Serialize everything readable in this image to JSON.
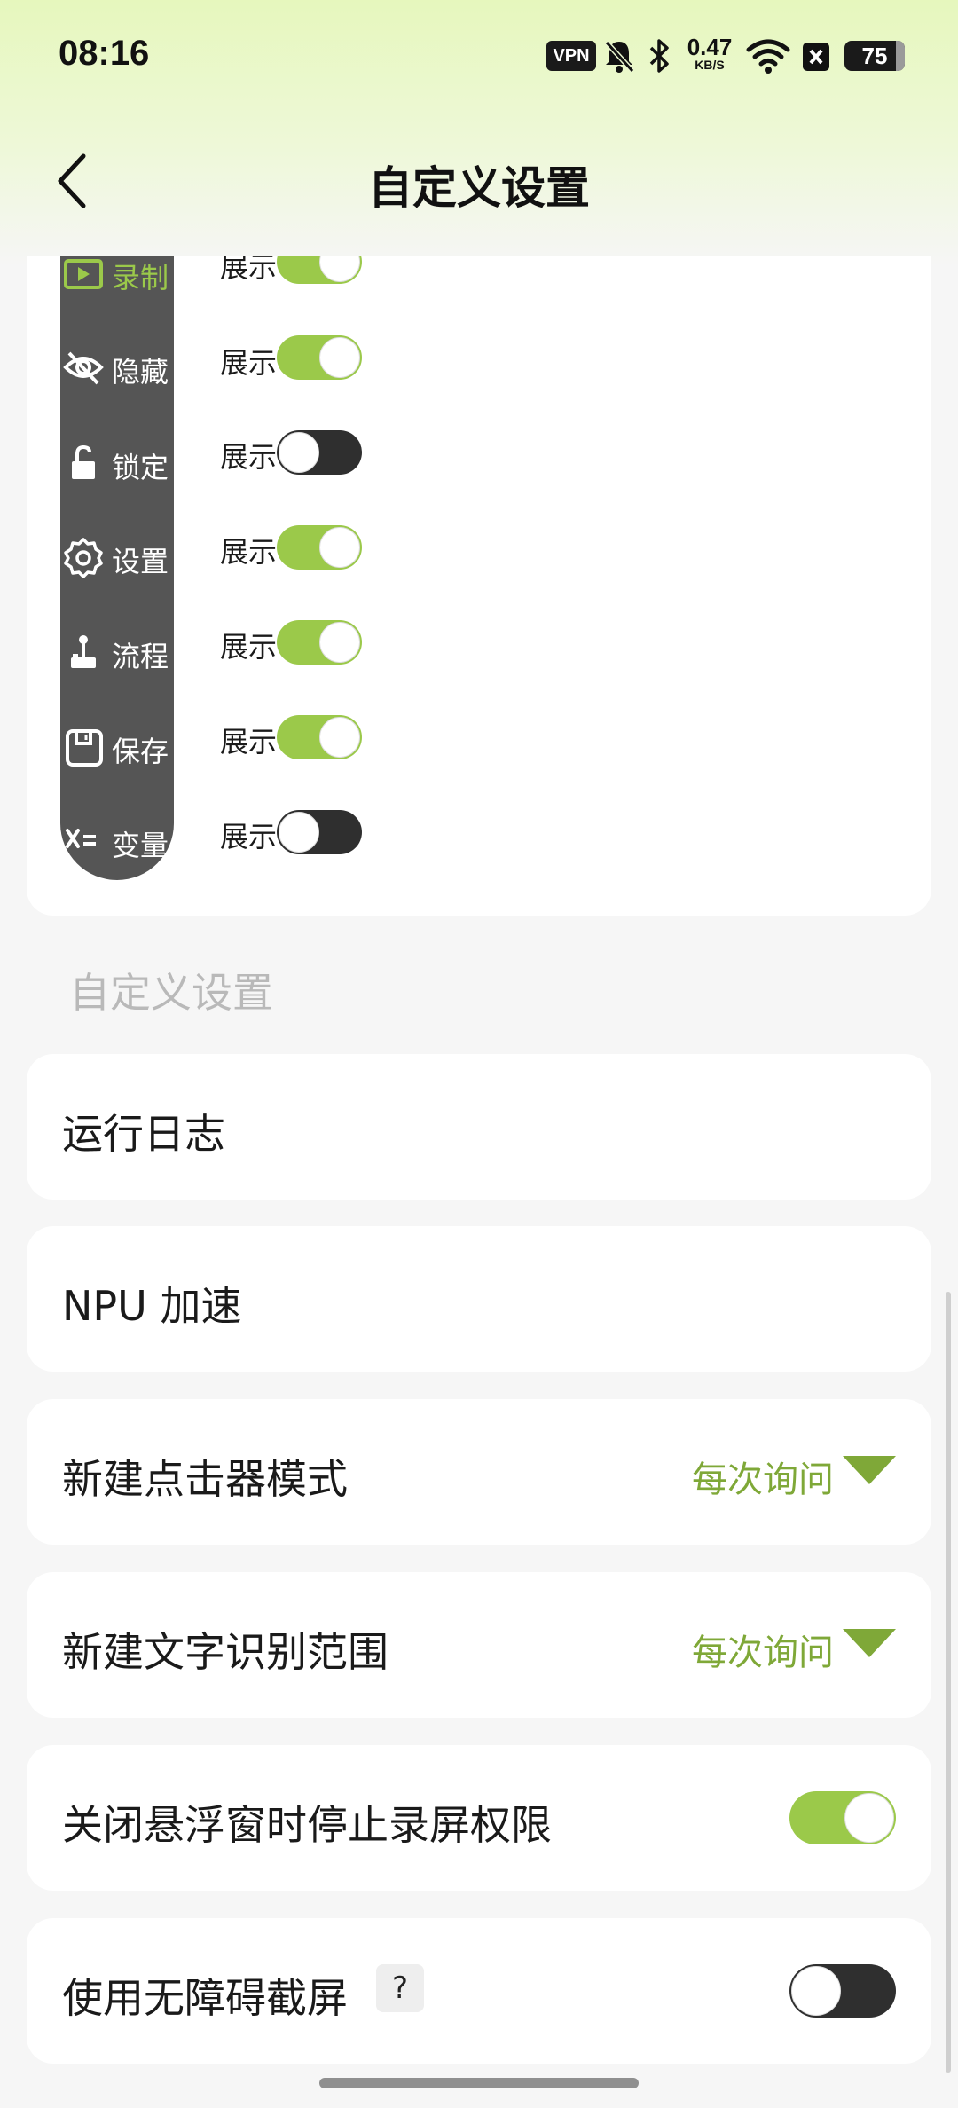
{
  "status_bar": {
    "time": "08:16",
    "vpn": "VPN",
    "net_speed": "0.47",
    "net_unit": "KB/S",
    "battery": "75"
  },
  "header": {
    "title": "自定义设置",
    "back_icon": "chevron-left-icon"
  },
  "float_bar": {
    "items": [
      {
        "label": "录制",
        "icon": "record-icon",
        "active": true,
        "toggle_label": "展示",
        "on": true
      },
      {
        "label": "隐藏",
        "icon": "eye-off-icon",
        "active": false,
        "toggle_label": "展示",
        "on": true
      },
      {
        "label": "锁定",
        "icon": "lock-icon",
        "active": false,
        "toggle_label": "展示",
        "on": false
      },
      {
        "label": "设置",
        "icon": "gear-icon",
        "active": false,
        "toggle_label": "展示",
        "on": true
      },
      {
        "label": "流程",
        "icon": "joystick-icon",
        "active": false,
        "toggle_label": "展示",
        "on": true
      },
      {
        "label": "保存",
        "icon": "save-icon",
        "active": false,
        "toggle_label": "展示",
        "on": true
      },
      {
        "label": "变量",
        "icon": "variable-icon",
        "active": false,
        "toggle_label": "展示",
        "on": false
      }
    ]
  },
  "section": {
    "title": "自定义设置"
  },
  "settings": [
    {
      "label": "运行日志"
    },
    {
      "label": "NPU 加速"
    },
    {
      "label": "新建点击器模式",
      "value": "每次询问"
    },
    {
      "label": "新建文字识别范围",
      "value": "每次询问"
    },
    {
      "label": "关闭悬浮窗时停止录屏权限",
      "on": true
    },
    {
      "label": "使用无障碍截屏",
      "help": "?",
      "on": false
    }
  ],
  "colors": {
    "accent": "#9bc94a",
    "accent_text": "#7fa838",
    "toggle_off": "#2f2f2f",
    "float_bar": "#555555"
  }
}
